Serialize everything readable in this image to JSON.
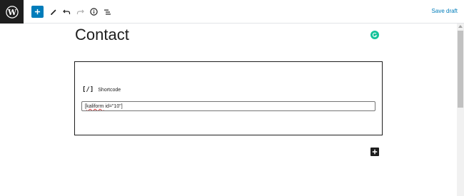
{
  "toolbar": {
    "logo_icon": "wordpress-logo-icon",
    "add_block_icon": "plus-icon",
    "tools_icon": "pencil-icon",
    "undo_icon": "undo-icon",
    "redo_icon": "redo-icon",
    "details_icon": "info-icon",
    "outline_icon": "list-view-icon",
    "save_draft_label": "Save draft"
  },
  "editor": {
    "title": "Contact",
    "grammarly_icon": "grammarly-icon",
    "shortcode_block": {
      "icon_text": "[/]",
      "label": "Shortcode",
      "value_misspelled": "kaliform",
      "value_prefix": "[",
      "value_suffix": " id=\"10\"]"
    },
    "block_inserter_icon": "plus-icon"
  },
  "colors": {
    "accent": "#007cba",
    "dark": "#1e1e1e",
    "grammarly": "#15c39a",
    "spellcheck": "#d63638"
  }
}
